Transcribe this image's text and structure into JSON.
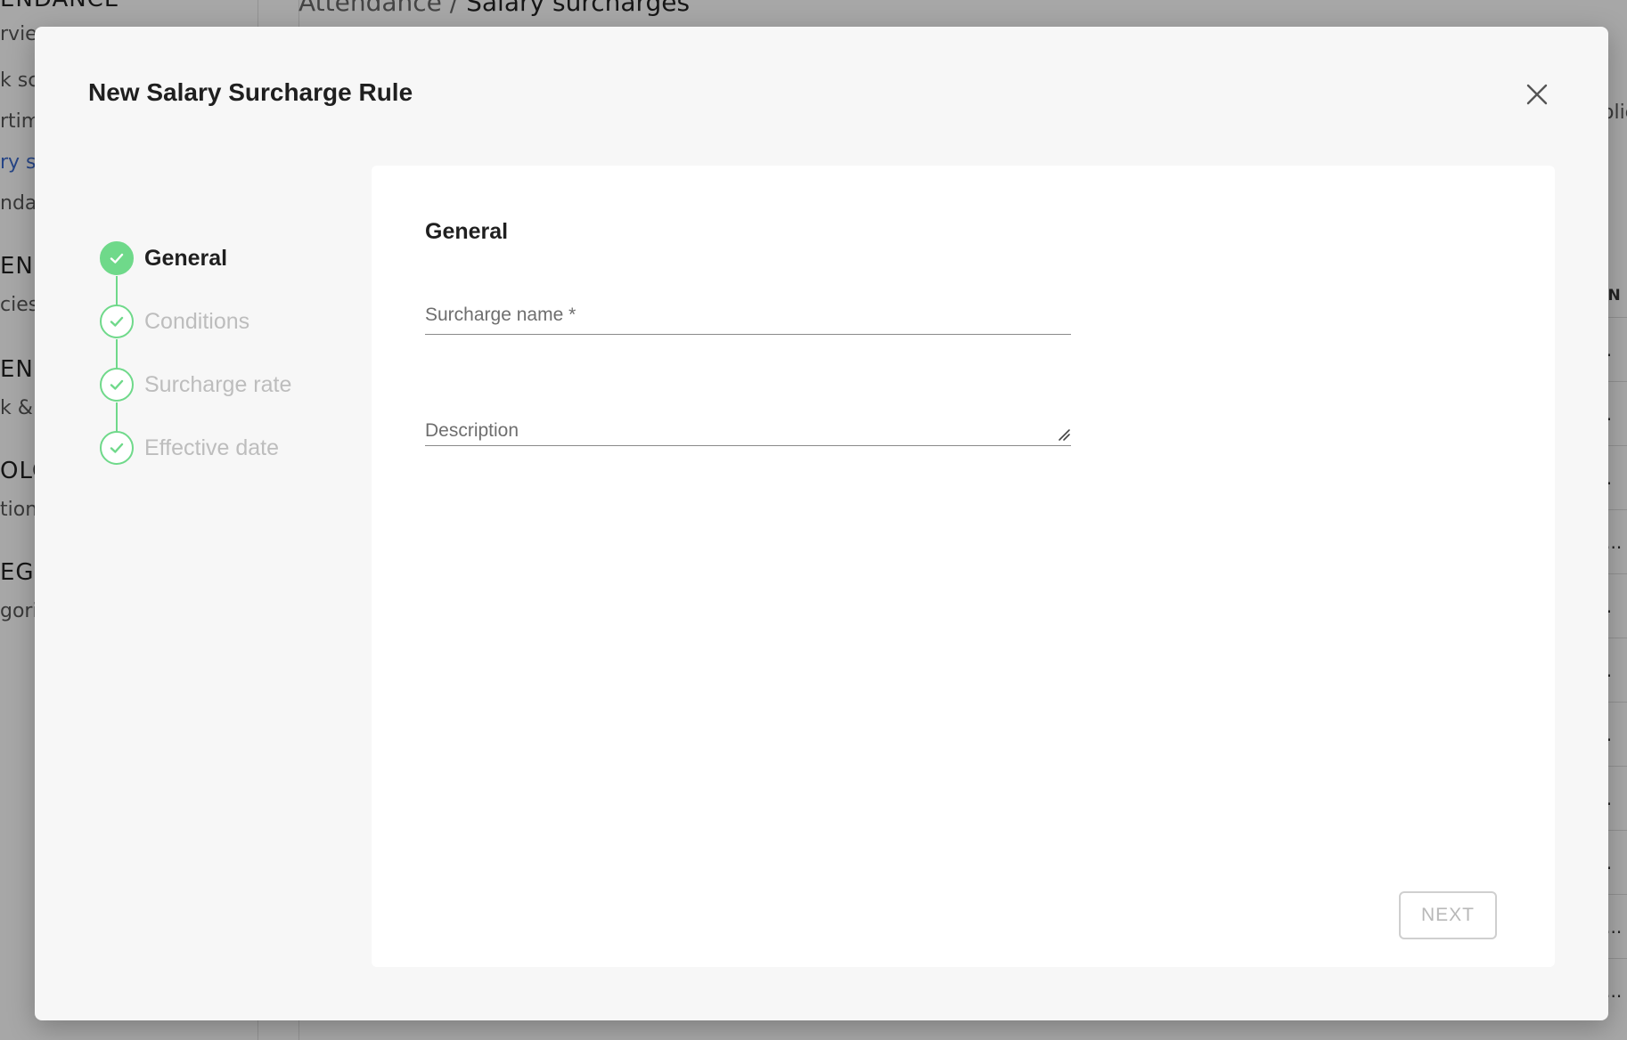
{
  "background": {
    "sidebar": [
      {
        "text": "ENDANCE",
        "kind": "head"
      },
      {
        "text": "rview",
        "kind": "item"
      },
      {
        "text": "k sch",
        "kind": "item"
      },
      {
        "text": "rtime",
        "kind": "item"
      },
      {
        "text": "ry su",
        "kind": "active"
      },
      {
        "text": "ndar",
        "kind": "item"
      },
      {
        "text": "END",
        "kind": "head"
      },
      {
        "text": "cies",
        "kind": "item"
      },
      {
        "text": "END",
        "kind": "head"
      },
      {
        "text": "k & s",
        "kind": "item"
      },
      {
        "text": "OLO",
        "kind": "head"
      },
      {
        "text": "tion",
        "kind": "item"
      },
      {
        "text": "EGO",
        "kind": "head"
      },
      {
        "text": "gori",
        "kind": "item"
      }
    ],
    "breadcrumb": {
      "parent": "Attendance / ",
      "current": "Salary surcharges"
    },
    "right_text": "olic",
    "table": {
      "header": "ON",
      "rows": [
        "...",
        "...",
        "...",
        "li...",
        "...",
        "...",
        "...",
        "...",
        "...",
        "li...",
        "li..."
      ]
    }
  },
  "modal": {
    "title": "New Salary Surcharge Rule",
    "close_icon": "close-icon",
    "accent_color": "#6fd98a",
    "steps": [
      {
        "label": "General",
        "state": "active"
      },
      {
        "label": "Conditions",
        "state": "pending"
      },
      {
        "label": "Surcharge rate",
        "state": "pending"
      },
      {
        "label": "Effective date",
        "state": "pending"
      }
    ],
    "section_title": "General",
    "fields": {
      "surcharge_name": {
        "placeholder": "Surcharge name *",
        "value": ""
      },
      "description": {
        "placeholder": "Description",
        "value": ""
      }
    },
    "next_label": "NEXT"
  }
}
